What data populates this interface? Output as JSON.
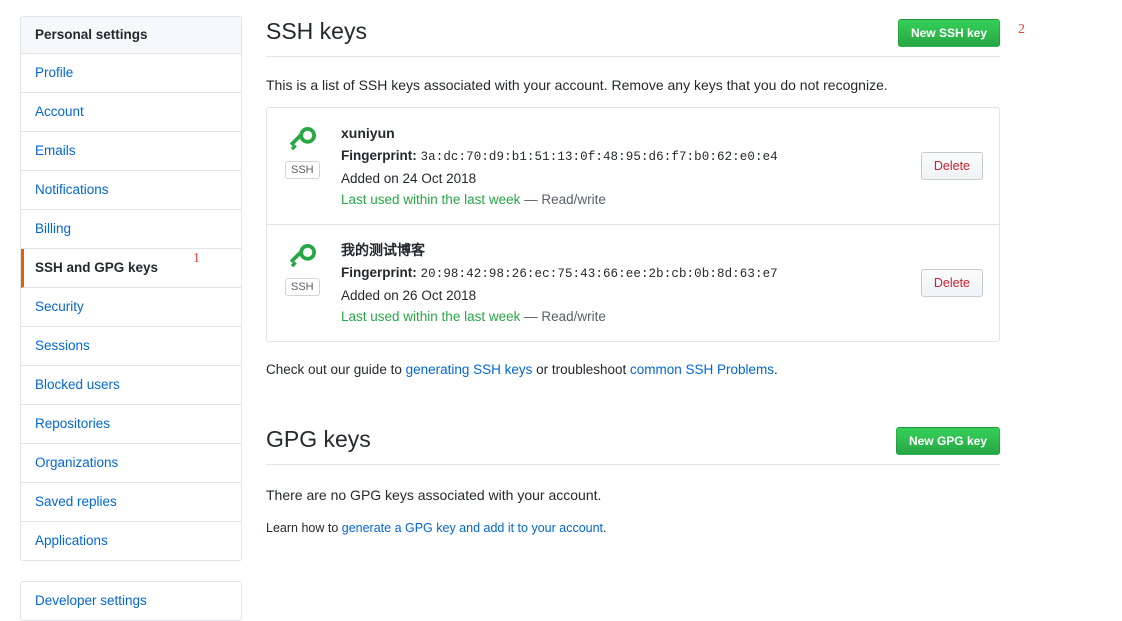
{
  "sidebar": {
    "header": "Personal settings",
    "items": [
      {
        "label": "Profile",
        "selected": false
      },
      {
        "label": "Account",
        "selected": false
      },
      {
        "label": "Emails",
        "selected": false
      },
      {
        "label": "Notifications",
        "selected": false
      },
      {
        "label": "Billing",
        "selected": false
      },
      {
        "label": "SSH and GPG keys",
        "selected": true
      },
      {
        "label": "Security",
        "selected": false
      },
      {
        "label": "Sessions",
        "selected": false
      },
      {
        "label": "Blocked users",
        "selected": false
      },
      {
        "label": "Repositories",
        "selected": false
      },
      {
        "label": "Organizations",
        "selected": false
      },
      {
        "label": "Saved replies",
        "selected": false
      },
      {
        "label": "Applications",
        "selected": false
      }
    ],
    "developer_settings": "Developer settings"
  },
  "ssh_section": {
    "title": "SSH keys",
    "new_button": "New SSH key",
    "description": "This is a list of SSH keys associated with your account. Remove any keys that you do not recognize.",
    "keys": [
      {
        "title": "xuniyun",
        "fingerprint_label": "Fingerprint:",
        "fingerprint": "3a:dc:70:d9:b1:51:13:0f:48:95:d6:f7:b0:62:e0:e4",
        "added": "Added on 24 Oct 2018",
        "last_used": "Last used within the last week",
        "access": "— Read/write",
        "badge": "SSH",
        "delete_label": "Delete"
      },
      {
        "title": "我的测试博客",
        "fingerprint_label": "Fingerprint:",
        "fingerprint": "20:98:42:98:26:ec:75:43:66:ee:2b:cb:0b:8d:63:e7",
        "added": "Added on 26 Oct 2018",
        "last_used": "Last used within the last week",
        "access": "— Read/write",
        "badge": "SSH",
        "delete_label": "Delete"
      }
    ],
    "help_prefix": "Check out our guide to ",
    "help_link1": "generating SSH keys",
    "help_middle": " or troubleshoot ",
    "help_link2": "common SSH Problems",
    "help_suffix": "."
  },
  "gpg_section": {
    "title": "GPG keys",
    "new_button": "New GPG key",
    "empty_message": "There are no GPG keys associated with your account.",
    "learn_prefix": "Learn how to ",
    "learn_link": "generate a GPG key and add it to your account",
    "learn_suffix": "."
  },
  "annotations": [
    {
      "number": "1",
      "target": "SSH and GPG keys"
    },
    {
      "number": "2",
      "target": "New SSH key"
    }
  ],
  "colors": {
    "link": "#0366d6",
    "green_button": "#28a745",
    "danger": "#cb2431",
    "annotation_red": "#fb2f2f",
    "active_bar": "#e36209",
    "border": "#e1e4e8"
  }
}
